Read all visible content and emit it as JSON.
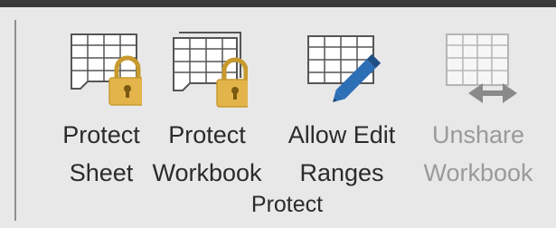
{
  "ribbon": {
    "group_label": "Protect",
    "commands": [
      {
        "line1": "Protect",
        "line2": "Sheet",
        "icon": "protect-sheet-icon",
        "enabled": true
      },
      {
        "line1": "Protect",
        "line2": "Workbook",
        "icon": "protect-workbook-icon",
        "enabled": true
      },
      {
        "line1": "Allow Edit",
        "line2": "Ranges",
        "icon": "allow-edit-ranges-icon",
        "enabled": true
      },
      {
        "line1": "Unshare",
        "line2": "Workbook",
        "icon": "unshare-workbook-icon",
        "enabled": false
      }
    ]
  },
  "colors": {
    "lock": "#e3b44a",
    "pencil": "#2d6fb6",
    "disabled_text": "#9a9a9a",
    "text": "#2b2b2b"
  }
}
